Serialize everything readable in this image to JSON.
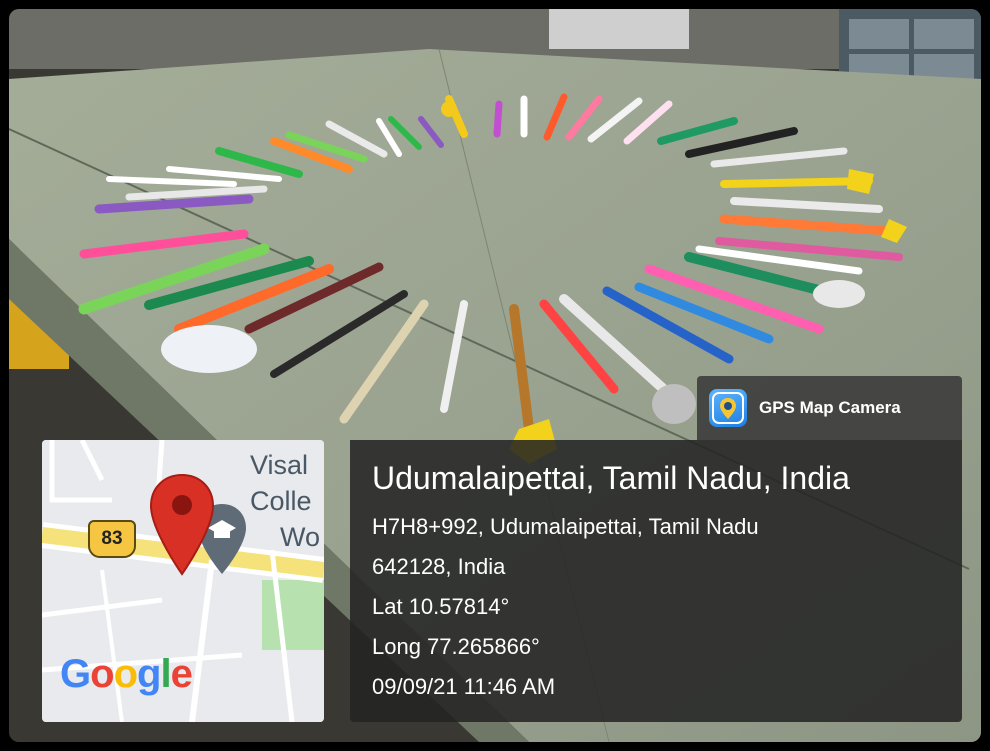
{
  "badge": {
    "app_name": "GPS Map Camera"
  },
  "location": {
    "title": "Udumalaipettai, Tamil Nadu, India",
    "address_line_1": "H7H8+992, Udumalaipettai, Tamil Nadu",
    "address_line_2": "642128, India",
    "latitude": "Lat 10.57814°",
    "longitude": "Long 77.265866°",
    "datetime": "09/09/21 11:46 AM"
  },
  "map": {
    "label_1": "Visal",
    "label_2": "Colle",
    "label_3": "Wo",
    "road_number": "83",
    "logo": "Google",
    "colors": {
      "pin": "#d93025",
      "road": "#f6e27a",
      "park": "#b7e2b0"
    }
  },
  "icons": [
    "map-pin-icon",
    "college-icon",
    "gps-camera-icon"
  ]
}
